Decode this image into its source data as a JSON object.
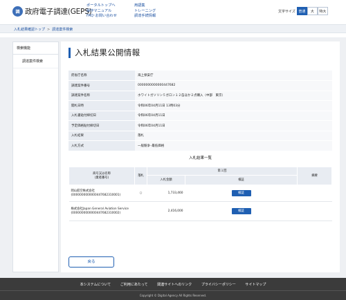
{
  "header": {
    "logo_mark": "調",
    "logo_text": "政府電子調達(GEPS)",
    "links_col1": [
      "ポータルトップへ",
      "操作マニュアル",
      "FAQ･お問い合わせ"
    ],
    "links_col2": [
      "用語集",
      "トレーニング",
      "調達手続情報"
    ],
    "font_size_label": "文字サイズ",
    "font_sizes": [
      "普通",
      "大",
      "特大"
    ]
  },
  "breadcrumb": [
    "入札結果確認トップ",
    "調達案件検索"
  ],
  "sidebar": {
    "heading": "検索機能",
    "items": [
      "調達案件検索"
    ]
  },
  "page_title": "入札結果公開情報",
  "info_rows": [
    {
      "key": "府省庁名称",
      "value": "海上保安庁"
    },
    {
      "key": "調達案件番号",
      "value": "0000000000000447682"
    },
    {
      "key": "調達案件名称",
      "value": "ホワイトガソリン５ガロン１２缶ほか２点購入（中部　東京）"
    },
    {
      "key": "開札日時",
      "value": "令和06年04月11日 13時03分"
    },
    {
      "key": "入札書貼付締切日",
      "value": "令和06年04月11日"
    },
    {
      "key": "予定価格貼付締切日",
      "value": "令和06年04月11日"
    },
    {
      "key": "入札結果",
      "value": "落札"
    },
    {
      "key": "入札方式",
      "value": "一般競争･最低価格"
    }
  ],
  "result_title": "入札結果一覧",
  "result_table": {
    "headers": {
      "company": "商号又は名称\n(業者番号)",
      "awarded": "落札",
      "round": "第１回",
      "amount": "入札金額",
      "detail": "検証",
      "remarks": "摘要"
    },
    "rows": [
      {
        "company": "岡山航空株式会社",
        "company_no": "(0000000000000447682310001)",
        "awarded": "○",
        "amount": "1,733,460",
        "button": "検証"
      },
      {
        "company": "株式会社Japan General Aviation Service",
        "company_no": "(0000000000000447682310002)",
        "awarded": "",
        "amount": "2,416,000",
        "button": "検証"
      }
    ]
  },
  "back_button": "戻る",
  "footer": {
    "links": [
      "本システムについて",
      "ご利用にあたって",
      "関連サイトへのリンク",
      "プライバシーポリシー",
      "サイトマップ"
    ],
    "copyright": "Copyright © Digital Agency All Rights Reserved."
  },
  "colors": {
    "accent": "#1f5fb2",
    "footer_bg": "#3b3b3b",
    "main_bg": "#eef0f3"
  }
}
